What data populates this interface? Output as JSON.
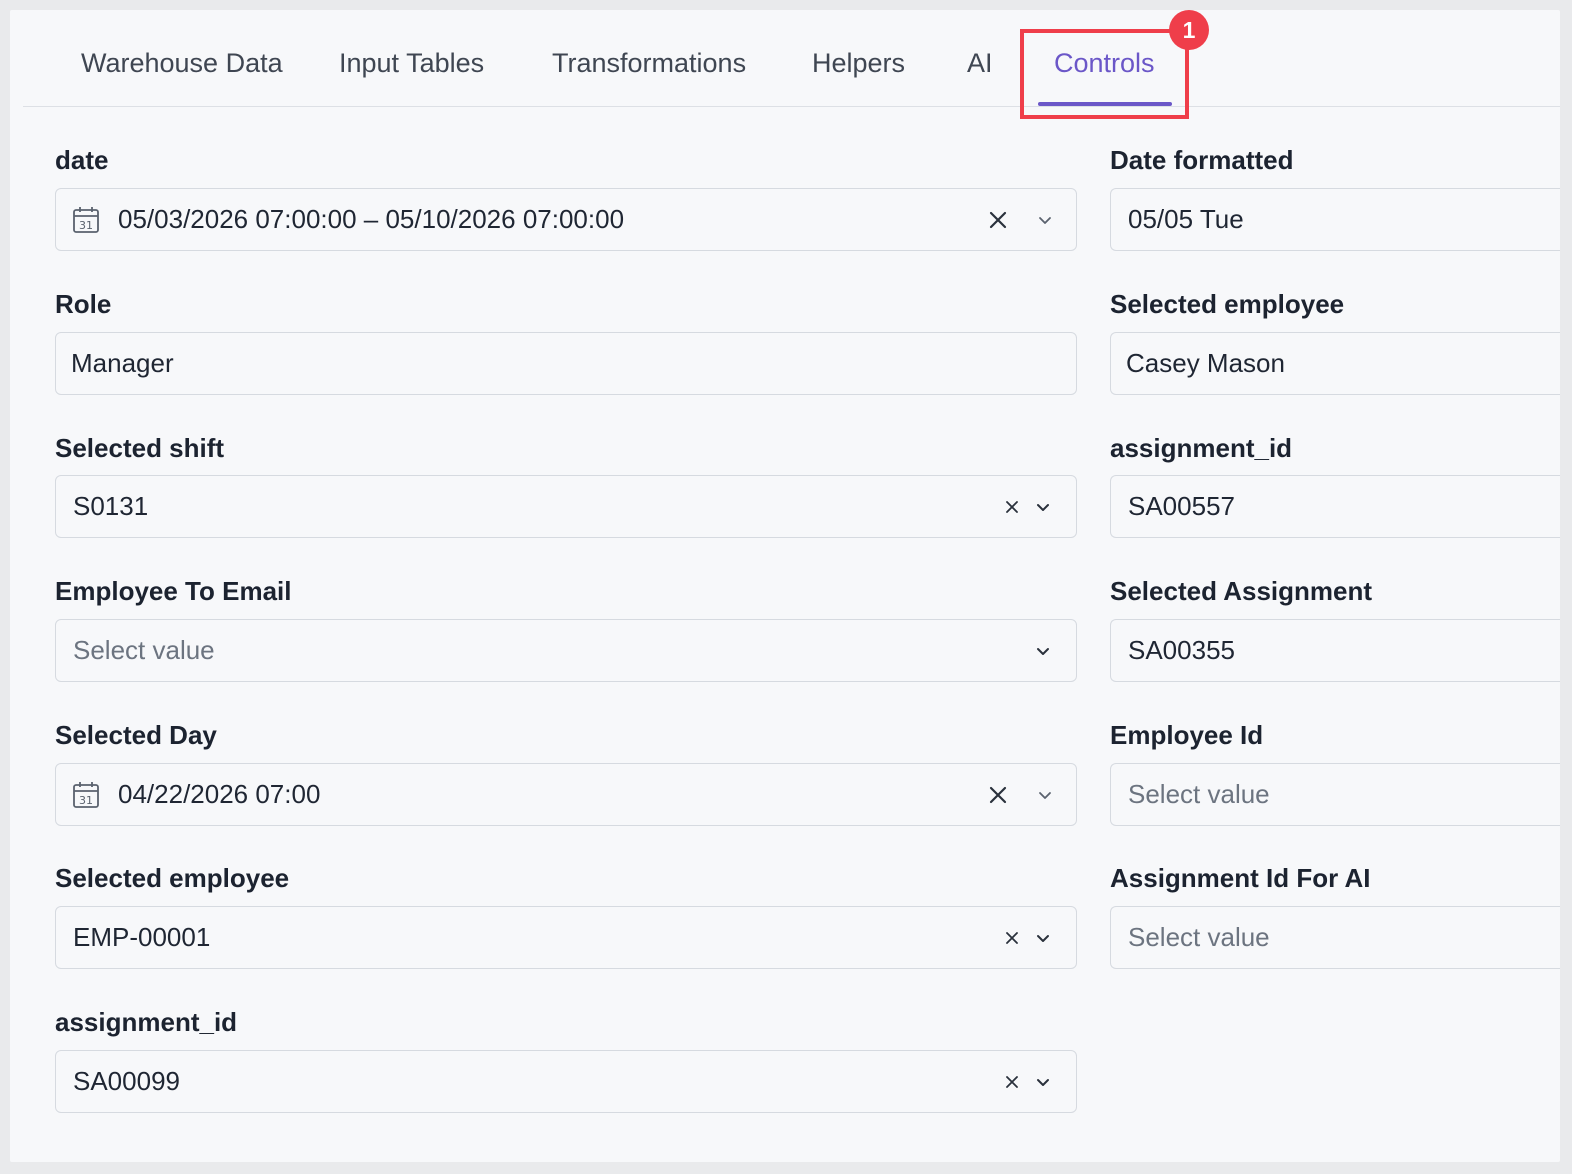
{
  "tabs": [
    {
      "label": "Warehouse Data"
    },
    {
      "label": "Input Tables"
    },
    {
      "label": "Transformations"
    },
    {
      "label": "Helpers"
    },
    {
      "label": "AI"
    },
    {
      "label": "Controls"
    }
  ],
  "active_tab": "Controls",
  "annotation_badge": "1",
  "colors": {
    "accent": "#6b57c8",
    "highlight": "#ef3e4a"
  },
  "left_controls": [
    {
      "label": "date",
      "value": "05/03/2026 07:00:00 – 05/10/2026 07:00:00",
      "type": "date-range",
      "clearable": true
    },
    {
      "label": "Role",
      "value": "Manager",
      "type": "text"
    },
    {
      "label": "Selected shift",
      "value": "S0131",
      "type": "select",
      "clearable": true
    },
    {
      "label": "Employee To Email",
      "placeholder": "Select value",
      "type": "select"
    },
    {
      "label": "Selected Day",
      "value": "04/22/2026 07:00",
      "type": "date",
      "clearable": true
    },
    {
      "label": "Selected employee",
      "value": "EMP-00001",
      "type": "select",
      "clearable": true
    },
    {
      "label": "assignment_id",
      "value": "SA00099",
      "type": "select",
      "clearable": true
    }
  ],
  "right_controls": [
    {
      "label": "Date formatted",
      "value": "05/05 Tue"
    },
    {
      "label": "Selected employee",
      "value": "Casey Mason"
    },
    {
      "label": "assignment_id",
      "value": "SA00557"
    },
    {
      "label": "Selected Assignment",
      "value": "SA00355"
    },
    {
      "label": "Employee Id",
      "placeholder": "Select value"
    },
    {
      "label": "Assignment Id For AI",
      "placeholder": "Select value"
    }
  ]
}
